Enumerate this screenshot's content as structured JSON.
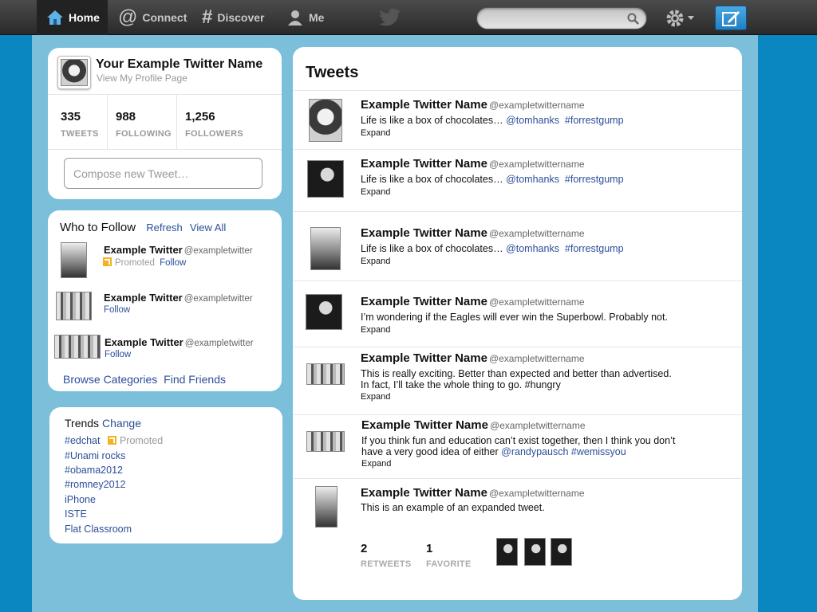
{
  "nav": {
    "home": "Home",
    "connect": "Connect",
    "discover": "Discover",
    "me": "Me",
    "search_placeholder": ""
  },
  "colors": {
    "accent": "#0b87c2",
    "link": "#2b4e9a",
    "topbar": "#333333"
  },
  "profile": {
    "name": "Your Example Twitter Name",
    "link": "View My Profile Page",
    "stats": [
      {
        "value": "335",
        "label": "TWEETS"
      },
      {
        "value": "988",
        "label": "FOLLOWING"
      },
      {
        "value": "1,256",
        "label": "FOLLOWERS"
      }
    ],
    "compose_placeholder": "Compose new Tweet…"
  },
  "who_to_follow": {
    "title": "Who to Follow",
    "refresh": "Refresh",
    "view_all": "View All",
    "items": [
      {
        "name": "Example Twitter",
        "handle": "@exampletwitter",
        "promoted": "Promoted",
        "follow": "Follow"
      },
      {
        "name": "Example Twitter",
        "handle": "@exampletwitter",
        "follow": "Follow"
      },
      {
        "name": "Example Twitter",
        "handle": "@exampletwitter",
        "follow": "Follow"
      }
    ],
    "browse": "Browse Categories",
    "find_friends": "Find Friends"
  },
  "trends": {
    "title": "Trends",
    "change": "Change",
    "promoted": "Promoted",
    "items": [
      "#edchat",
      "#Unami rocks",
      "#obama2012",
      "#romney2012",
      "iPhone",
      "ISTE",
      "Flat Classroom"
    ]
  },
  "tweets": {
    "title": "Tweets",
    "expand": "Expand",
    "items": [
      {
        "name": "Example Twitter Name",
        "handle": "@exampletwittername",
        "text": "Life is like a box of chocolates…",
        "mention": "@tomhanks",
        "hashtag": "#forrestgump"
      },
      {
        "name": "Example Twitter Name",
        "handle": "@exampletwittername",
        "text": "Life is like a box of chocolates…",
        "mention": "@tomhanks",
        "hashtag": "#forrestgump"
      },
      {
        "name": "Example Twitter Name",
        "handle": "@exampletwittername",
        "text": "Life is like a box of chocolates…",
        "mention": "@tomhanks",
        "hashtag": "#forrestgump"
      },
      {
        "name": "Example Twitter Name",
        "handle": "@exampletwittername",
        "text": "I’m wondering if the Eagles will ever win the Superbowl. Probably not."
      },
      {
        "name": "Example Twitter Name",
        "handle": "@exampletwittername",
        "text": "This is really exciting. Better than expected and better than advertised.",
        "text2": "In fact, I’ll take the whole thing to go. #hungry"
      },
      {
        "name": "Example Twitter Name",
        "handle": "@exampletwittername",
        "text": "If you think fun and education can’t exist together, then I think you don’t",
        "text2": "have a very good idea of either",
        "mention": "@randypausch",
        "hashtag": "#wemissyou"
      },
      {
        "name": "Example Twitter Name",
        "handle": "@exampletwittername",
        "text": "This is an example of an expanded tweet.",
        "retweets": "2",
        "retweets_label": "RETWEETS",
        "favorites": "1",
        "favorites_label": "FAVORITE"
      }
    ]
  }
}
